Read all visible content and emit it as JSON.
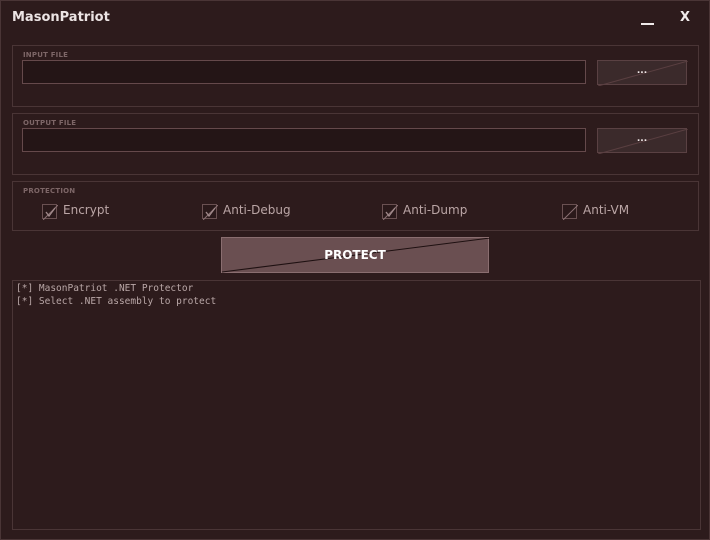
{
  "app": {
    "title": "MasonPatriot",
    "minimize_icon": "minimize-icon",
    "close_label": "X"
  },
  "input_file": {
    "label": "INPUT FILE",
    "value": "",
    "browse_label": "..."
  },
  "output_file": {
    "label": "OUTPUT FILE",
    "value": "",
    "browse_label": "..."
  },
  "protection": {
    "label": "PROTECTION",
    "options": [
      {
        "label": "Encrypt",
        "checked": true
      },
      {
        "label": "Anti-Debug",
        "checked": true
      },
      {
        "label": "Anti-Dump",
        "checked": true
      },
      {
        "label": "Anti-VM",
        "checked": false
      }
    ]
  },
  "protect_button": {
    "label": "PROTECT"
  },
  "log": {
    "lines": [
      "[*] MasonPatriot .NET Protector",
      "[*] Select .NET assembly to protect"
    ]
  },
  "colors": {
    "background": "#2d1b1c",
    "border": "#4a3536",
    "button": "#6a4f51",
    "text": "#bba6a6"
  }
}
